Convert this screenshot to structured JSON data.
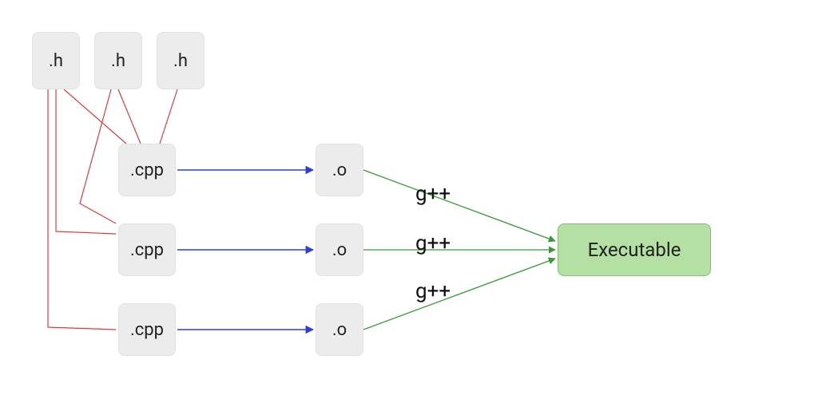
{
  "nodes": {
    "h1": {
      "label": ".h"
    },
    "h2": {
      "label": ".h"
    },
    "h3": {
      "label": ".h"
    },
    "cpp1": {
      "label": ".cpp"
    },
    "cpp2": {
      "label": ".cpp"
    },
    "cpp3": {
      "label": ".cpp"
    },
    "o1": {
      "label": ".o"
    },
    "o2": {
      "label": ".o"
    },
    "o3": {
      "label": ".o"
    },
    "exe": {
      "label": "Executable"
    }
  },
  "edge_labels": {
    "link1": "g++",
    "link2": "g++",
    "link3": "g++"
  },
  "colors": {
    "header_edge": "#e23b3b",
    "compile_edge": "#2a3fe0",
    "link_edge": "#3a9a3a",
    "node_bg": "#ececec",
    "exe_bg": "#b5e0a3",
    "exe_border": "#82c178"
  }
}
